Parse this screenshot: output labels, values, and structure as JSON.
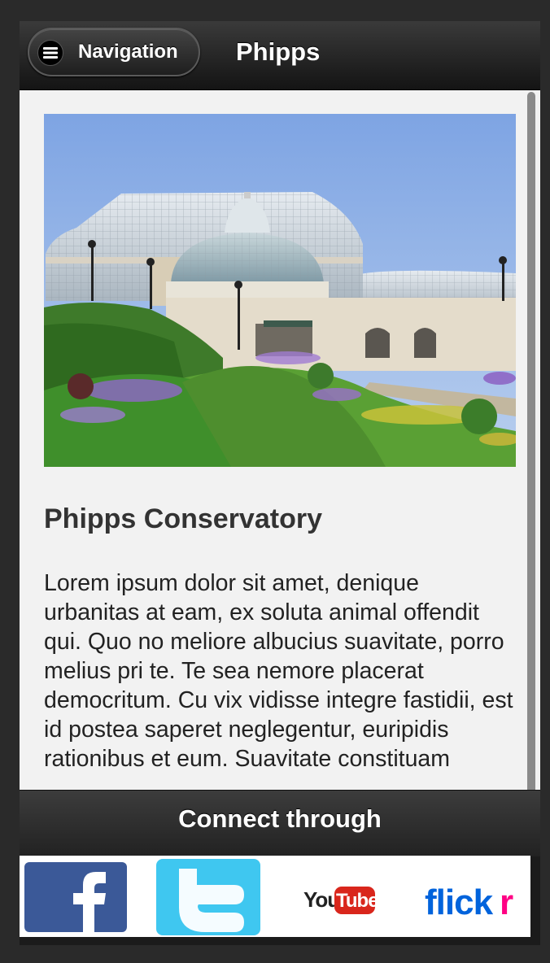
{
  "header": {
    "nav_label": "Navigation",
    "title": "Phipps"
  },
  "main": {
    "heading": "Phipps Conservatory",
    "body": "Lorem ipsum dolor sit amet, denique urbanitas at eam, ex soluta animal offendit qui. Quo no meliore albucius suavitate, porro melius pri te. Te sea nemore placerat democritum. Cu vix vidisse integre fastidii, est id postea saperet neglegentur, euripidis rationibus et eum. Suavitate constituam"
  },
  "footer": {
    "title": "Connect through"
  },
  "social": {
    "youtube_you": "You",
    "youtube_tube": "Tube",
    "flickr_flick": "flick",
    "flickr_r": "r",
    "colors": {
      "facebook": "#3b5998",
      "twitter": "#3fc7f0",
      "youtube": "#d9261c",
      "flickr_blue": "#0063dc",
      "flickr_pink": "#ff0084"
    }
  },
  "icons": {
    "nav": "hamburger-icon",
    "facebook": "facebook-icon",
    "twitter": "twitter-icon",
    "youtube": "youtube-icon",
    "flickr": "flickr-icon"
  }
}
